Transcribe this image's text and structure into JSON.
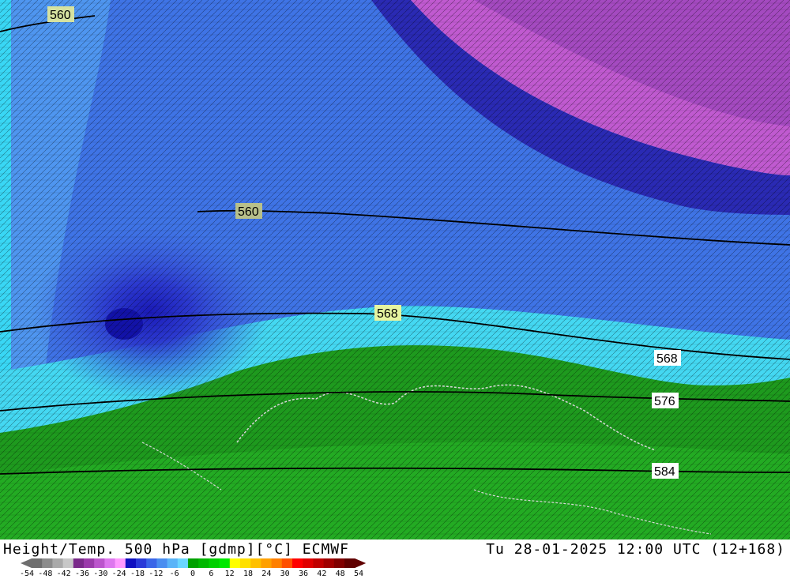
{
  "title_left": "Height/Temp. 500 hPa [gdmp][°C] ECMWF",
  "title_right": "Tu 28-01-2025 12:00 UTC (12+168)",
  "contour_labels": [
    "560",
    "560",
    "568",
    "568",
    "576",
    "584"
  ],
  "colorbar": {
    "ticks": [
      "-54",
      "-48",
      "-42",
      "-36",
      "-30",
      "-24",
      "-18",
      "-12",
      "-6",
      "0",
      "6",
      "12",
      "18",
      "24",
      "30",
      "36",
      "42",
      "48",
      "54"
    ],
    "colors": [
      "#6e6e6e",
      "#8c8c8c",
      "#aaaaaa",
      "#c8c8c8",
      "#7a2a8a",
      "#9a3aaa",
      "#bb55cc",
      "#dd77ee",
      "#ff99ff",
      "#1010c0",
      "#2a3ad8",
      "#3a66e8",
      "#4a8ef0",
      "#5ab4f8",
      "#6ad6ff",
      "#00a000",
      "#00b800",
      "#00d000",
      "#00e800",
      "#ffff00",
      "#ffe000",
      "#ffc000",
      "#ffa000",
      "#ff8000",
      "#ff5000",
      "#ff0000",
      "#e00000",
      "#c00000",
      "#a00000",
      "#800000",
      "#600000"
    ]
  }
}
